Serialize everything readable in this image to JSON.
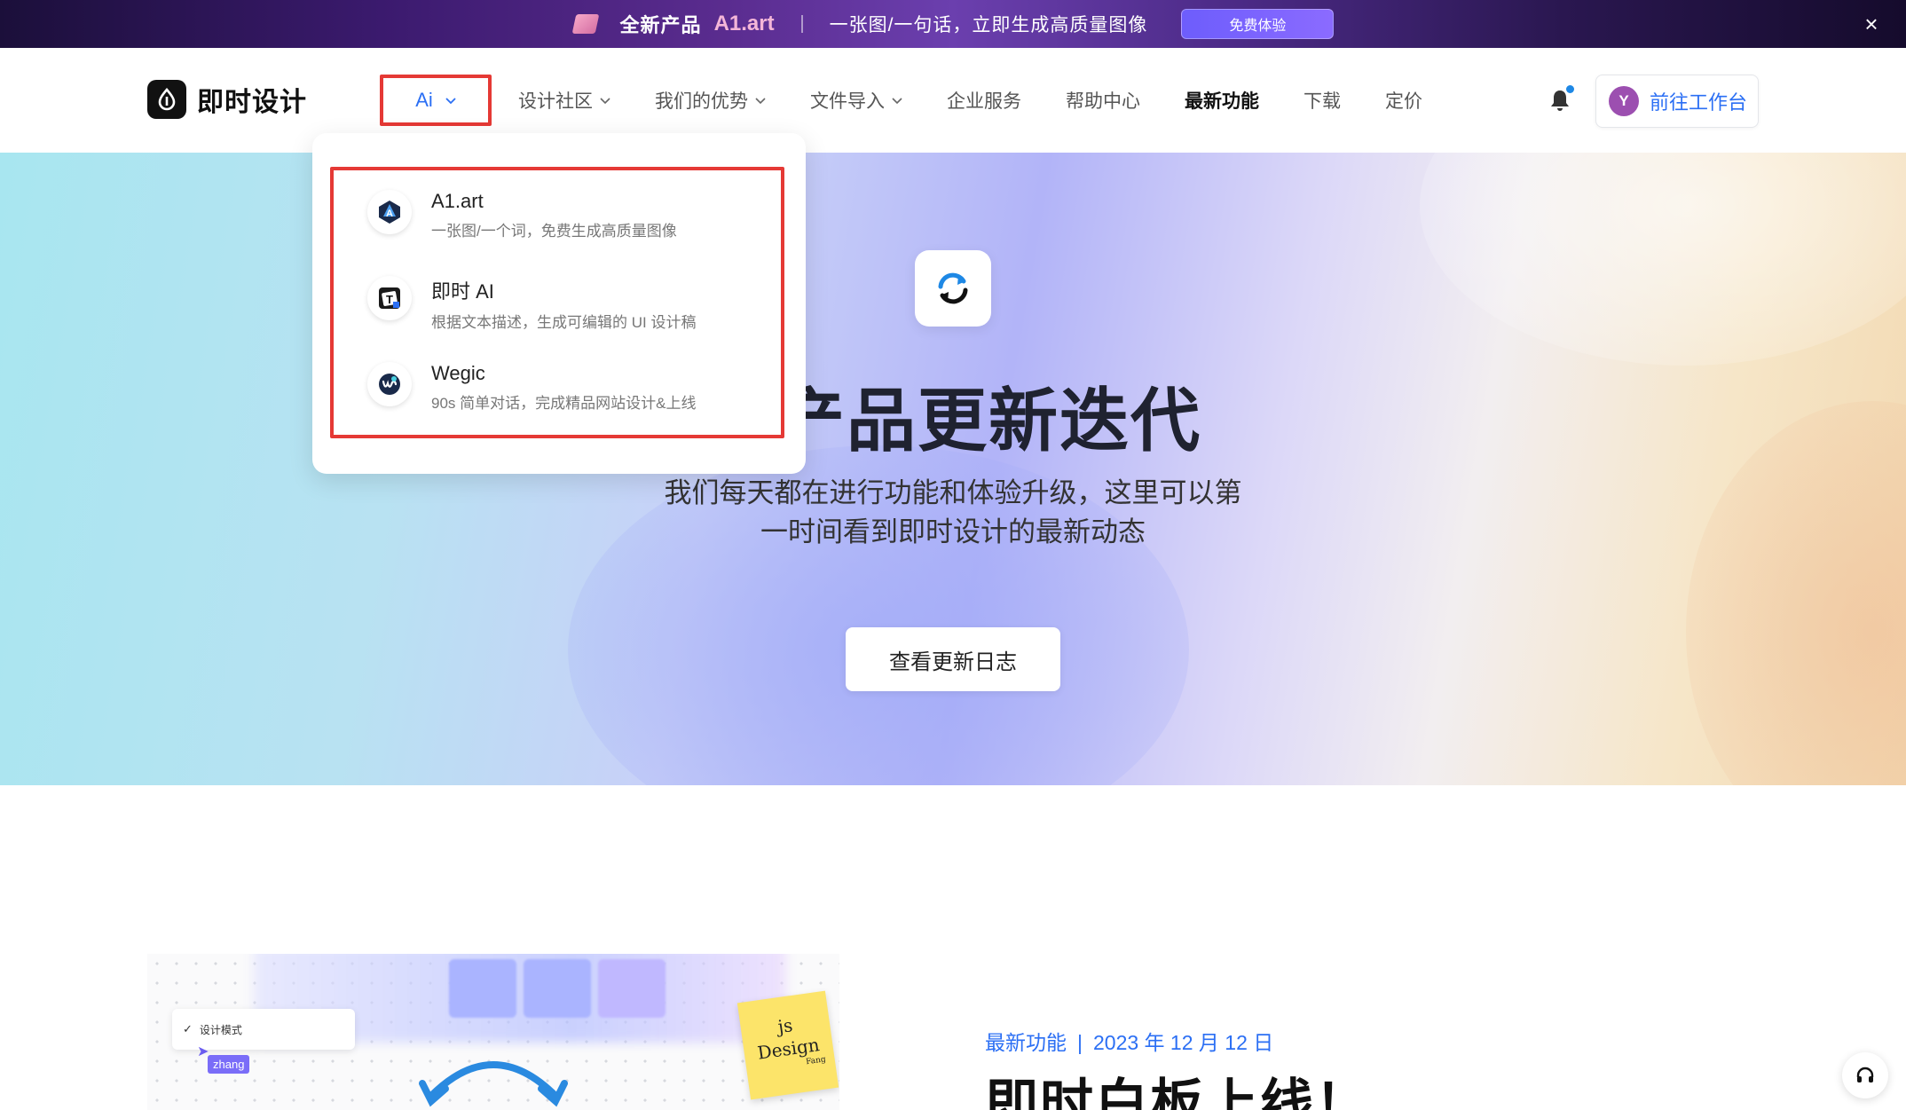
{
  "promo": {
    "title": "全新产品",
    "brand": "A1.art",
    "slogan": "一张图/一句话，立即生成高质量图像",
    "cta": "免费体验"
  },
  "header": {
    "logo_text": "即时设计",
    "nav": [
      {
        "label": "Ai",
        "has_dropdown": true,
        "state": "open"
      },
      {
        "label": "设计社区",
        "has_dropdown": true
      },
      {
        "label": "我们的优势",
        "has_dropdown": true
      },
      {
        "label": "文件导入",
        "has_dropdown": true
      },
      {
        "label": "企业服务",
        "has_dropdown": false
      },
      {
        "label": "帮助中心",
        "has_dropdown": false
      },
      {
        "label": "最新功能",
        "has_dropdown": false,
        "active": true
      },
      {
        "label": "下载",
        "has_dropdown": false
      },
      {
        "label": "定价",
        "has_dropdown": false
      }
    ],
    "avatar_letter": "Y",
    "workbench_label": "前往工作台"
  },
  "dropdown": {
    "items": [
      {
        "name": "A1.art",
        "desc": "一张图/一个词，免费生成高质量图像",
        "icon": "a1art-icon"
      },
      {
        "name": "即时 AI",
        "desc": "根据文本描述，生成可编辑的 UI 设计稿",
        "icon": "jishi-ai-icon"
      },
      {
        "name": "Wegic",
        "desc": "90s 简单对话，完成精品网站设计&上线",
        "icon": "wegic-icon"
      }
    ]
  },
  "hero": {
    "headline": "的产品更新迭代",
    "subtitle_line1": "我们每天都在进行功能和体验升级，这里可以第",
    "subtitle_line2": "一时间看到即时设计的最新动态",
    "cta": "查看更新日志"
  },
  "feature": {
    "image": {
      "check_label": "设计模式",
      "user_tag": "zhang",
      "note_line1": "js",
      "note_line2": "Design",
      "note_sign": "Fang"
    },
    "category": "最新功能",
    "date": "2023 年 12 月 12 日",
    "title": "即时白板上线！"
  },
  "colors": {
    "accent": "#2b6ff4",
    "highlight_border": "#e53935",
    "avatar": "#9c4fb0"
  }
}
